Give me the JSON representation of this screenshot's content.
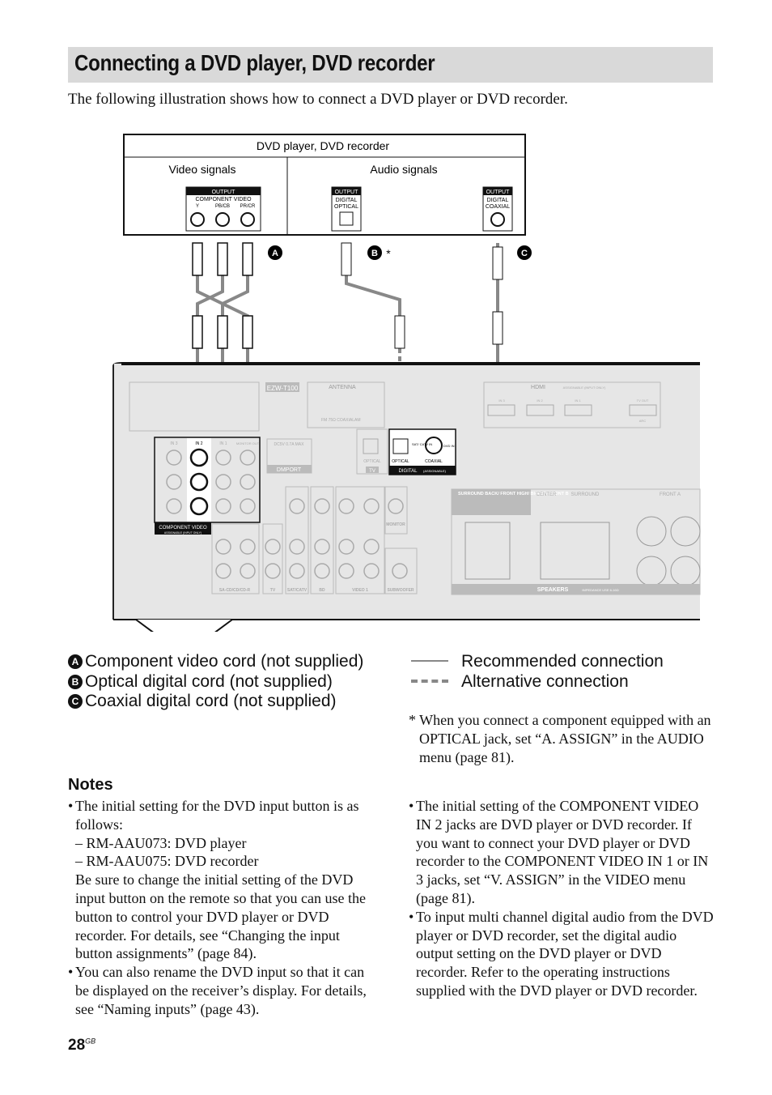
{
  "title": "Connecting a DVD player, DVD recorder",
  "intro": "The following illustration shows how to connect a DVD player or DVD recorder.",
  "diagram": {
    "device_title": "DVD player, DVD recorder",
    "video_signals": "Video signals",
    "audio_signals": "Audio signals",
    "output": "OUTPUT",
    "component_video": "COMPONENT VIDEO",
    "y": "Y",
    "pb": "PB/CB",
    "pr": "PR/CR",
    "digital": "DIGITAL",
    "optical": "OPTICAL",
    "coaxial": "COAXIAL",
    "cord_a": "A",
    "cord_b": "B",
    "cord_c": "C",
    "asterisk": "*",
    "receiver": {
      "ezw": "EZW-T100",
      "antenna": "ANTENNA",
      "fm": "FM 75Ω COAXIAL",
      "am": "AM",
      "hdmi": "HDMI",
      "hdmi_note": "ASSIGNABLE (INPUT ONLY)",
      "hdmi_ports": [
        "IN 3",
        "IN 2",
        "IN 1",
        "TV OUT"
      ],
      "arc": "ARC",
      "in3": "IN 3",
      "in2": "IN 2",
      "in1": "IN 1",
      "monitor_out": "MONITOR OUT",
      "comp_video": "COMPONENT VIDEO",
      "comp_note": "ASSIGNABLE (INPUT ONLY)",
      "dmport": "DMPORT",
      "dc": "DC5V 0.7A MAX",
      "tv": "TV",
      "optical": "OPTICAL",
      "digital": "DIGITAL",
      "assignable": "(ASSIGNABLE)",
      "sat_in": "SAT/ CATV IN",
      "dvd_in": "DVD IN",
      "opt": "OPTICAL",
      "coax": "COAXIAL",
      "groups": [
        "SA-CD/CD/CD-R",
        "TV",
        "SAT/CATV",
        "BD",
        "VIDEO 1",
        "SUBWOOFER",
        "MONITOR"
      ],
      "surround_back": "SURROUND BACK/ FRONT HIGH/ BI-AMP/ FRONT B",
      "center": "CENTER",
      "surround": "SURROUND",
      "front_a": "FRONT A",
      "speakers": "SPEAKERS",
      "impedance": "IMPEDANCE USE 6-16Ω"
    }
  },
  "legend": {
    "a": "Component video cord (not supplied)",
    "b": "Optical digital cord (not supplied)",
    "c": "Coaxial digital cord (not supplied)",
    "recommended": "Recommended connection",
    "alternative": "Alternative connection"
  },
  "footnote": "* When you connect a component equipped with an OPTICAL jack, set “A. ASSIGN” in the AUDIO menu (page 81).",
  "notes": {
    "heading": "Notes",
    "left": [
      {
        "text": "The initial setting for the DVD input button is as follows:",
        "subs": [
          "– RM-AAU073: DVD player",
          "– RM-AAU075: DVD recorder"
        ],
        "after": "Be sure to change the initial setting of the DVD input button on the remote so that you can use the button to control your DVD player or DVD recorder. For details, see “Changing the input button assignments” (page 84)."
      },
      {
        "text": "You can also rename the DVD input so that it can be displayed on the receiver’s display. For details, see “Naming inputs” (page 43)."
      }
    ],
    "right": [
      "The initial setting of the COMPONENT VIDEO IN 2 jacks are DVD player or DVD recorder. If you want to connect your DVD player or DVD recorder to the COMPONENT VIDEO IN 1 or IN 3 jacks, set “V. ASSIGN” in the VIDEO menu (page 81).",
      "To input multi channel digital audio from the DVD player or DVD recorder, set the digital audio output setting on the DVD player or DVD recorder. Refer to the operating instructions supplied with the DVD player or DVD recorder."
    ]
  },
  "page_number": "28",
  "page_suffix": "GB",
  "colors": {
    "title_bar": "#d9d9d9",
    "panel": "#e6e6e6",
    "cable": "#888888"
  }
}
